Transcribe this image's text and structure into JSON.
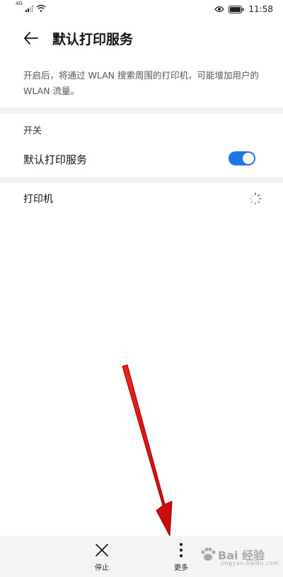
{
  "status_bar": {
    "network_label": "4G",
    "time": "11:58",
    "icons": [
      "signal-icon",
      "wifi-icon",
      "eye-icon",
      "battery-icon"
    ]
  },
  "header": {
    "title": "默认打印服务",
    "back_icon": "back-arrow-icon"
  },
  "description": "开启后，将通过 WLAN 搜索周围的打印机，可能增加用户的 WLAN 流量。",
  "switch_section": {
    "label": "开关",
    "item_label": "默认打印服务",
    "toggle_on": true,
    "toggle_color": "#1f74e8"
  },
  "printers_section": {
    "label": "打印机",
    "loading_icon": "loading-spinner-icon"
  },
  "bottom_bar": {
    "stop_label": "停止",
    "more_label": "更多"
  },
  "watermark": {
    "text": "Bai 经验",
    "sub": "jingyan.baidu.com"
  },
  "annotation": {
    "color": "#e01010",
    "icon": "red-arrow-annotation"
  }
}
